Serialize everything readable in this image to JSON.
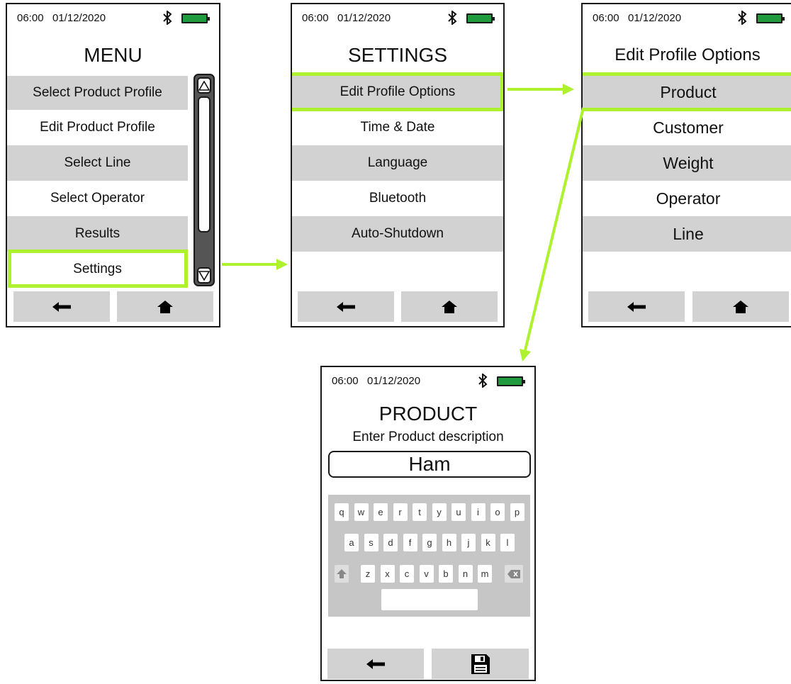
{
  "status": {
    "time": "06:00",
    "date": "01/12/2020"
  },
  "menu": {
    "title": "MENU",
    "items": [
      {
        "label": "Select Product Profile"
      },
      {
        "label": "Edit Product Profile"
      },
      {
        "label": "Select Line"
      },
      {
        "label": "Select Operator"
      },
      {
        "label": "Results"
      },
      {
        "label": "Settings"
      }
    ]
  },
  "settings": {
    "title": "SETTINGS",
    "items": [
      {
        "label": "Edit Profile Options"
      },
      {
        "label": "Time & Date"
      },
      {
        "label": "Language"
      },
      {
        "label": "Bluetooth"
      },
      {
        "label": "Auto-Shutdown"
      }
    ]
  },
  "profile_options": {
    "title": "Edit Profile Options",
    "items": [
      {
        "label": "Product"
      },
      {
        "label": "Customer"
      },
      {
        "label": "Weight"
      },
      {
        "label": "Operator"
      },
      {
        "label": "Line"
      }
    ]
  },
  "product": {
    "title": "PRODUCT",
    "subtitle": "Enter Product description",
    "value": "Ham"
  },
  "keyboard": {
    "rows": [
      [
        "q",
        "w",
        "e",
        "r",
        "t",
        "y",
        "u",
        "i",
        "o",
        "p"
      ],
      [
        "a",
        "s",
        "d",
        "f",
        "g",
        "h",
        "j",
        "k",
        "l"
      ],
      [
        "z",
        "x",
        "c",
        "v",
        "b",
        "n",
        "m"
      ]
    ]
  },
  "icons": {
    "back": "left-arrow-icon",
    "home": "home-icon",
    "save": "floppy-disk-icon",
    "shift": "shift-icon",
    "backspace": "backspace-icon",
    "bluetooth": "bluetooth-icon",
    "battery": "battery-icon"
  },
  "colors": {
    "highlight": "#aef22f",
    "row_shade": "#d3d2d2",
    "battery": "#1f9a3c",
    "keyboard_bg": "#c7c6c6"
  }
}
